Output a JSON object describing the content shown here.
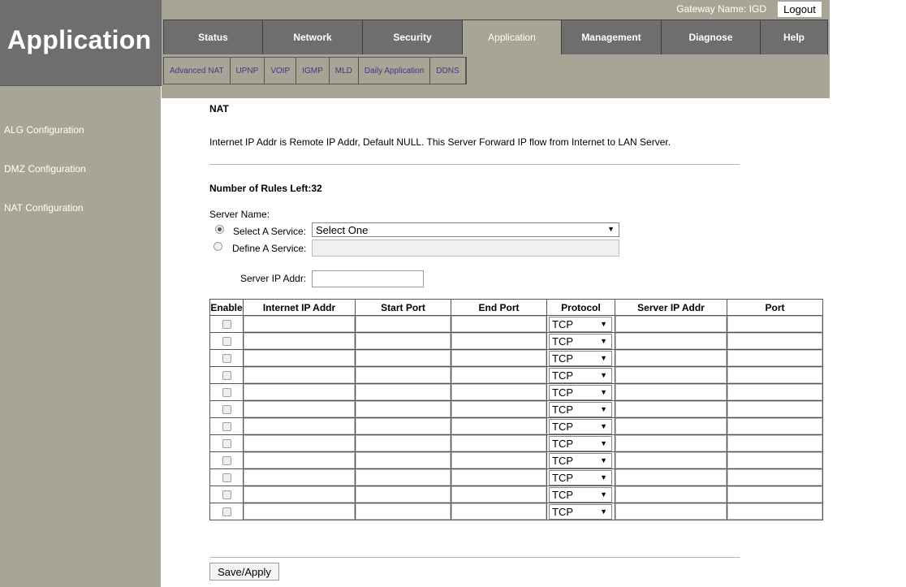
{
  "brand": {
    "title": "Application"
  },
  "topbar": {
    "gateway_label": "Gateway Name: IGD",
    "logout": "Logout"
  },
  "main_tabs": [
    {
      "label": "Status"
    },
    {
      "label": "Network"
    },
    {
      "label": "Security"
    },
    {
      "label": "Application",
      "active": true
    },
    {
      "label": "Management"
    },
    {
      "label": "Diagnose"
    },
    {
      "label": "Help"
    }
  ],
  "sub_tabs": [
    "Advanced NAT",
    "UPNP",
    "VOIP",
    "IGMP",
    "MLD",
    "Daily Application",
    "DDNS"
  ],
  "sidebar": {
    "items": [
      {
        "label": "ALG Configuration"
      },
      {
        "label": "DMZ Configuration"
      },
      {
        "label": "NAT Configuration"
      }
    ]
  },
  "content": {
    "title": "NAT",
    "description": "Internet IP Addr is Remote IP Addr, Default NULL. This Server Forward IP flow from Internet to LAN Server.",
    "rules_left": "Number of Rules Left:32",
    "server_name_label": "Server Name:",
    "select_service_label": "Select A Service:",
    "select_service_value": "Select One",
    "define_service_label": "Define A Service:",
    "define_service_value": "",
    "server_ip_label": "Server IP Addr:",
    "server_ip_value": "",
    "selected_mode": "select",
    "table": {
      "headers": [
        "Enable",
        "Internet IP Addr",
        "Start Port",
        "End Port",
        "Protocol",
        "Server IP Addr",
        "Port"
      ],
      "rows": [
        {
          "enable": false,
          "protocol": "TCP"
        },
        {
          "enable": false,
          "protocol": "TCP"
        },
        {
          "enable": false,
          "protocol": "TCP"
        },
        {
          "enable": false,
          "protocol": "TCP"
        },
        {
          "enable": false,
          "protocol": "TCP"
        },
        {
          "enable": false,
          "protocol": "TCP"
        },
        {
          "enable": false,
          "protocol": "TCP"
        },
        {
          "enable": false,
          "protocol": "TCP"
        },
        {
          "enable": false,
          "protocol": "TCP"
        },
        {
          "enable": false,
          "protocol": "TCP"
        },
        {
          "enable": false,
          "protocol": "TCP"
        },
        {
          "enable": false,
          "protocol": "TCP"
        }
      ]
    },
    "save_label": "Save/Apply"
  },
  "colors": {
    "chrome_dark": "#6e6e6e",
    "chrome_light": "#a8a596",
    "subnav_text": "#3a3a8a"
  }
}
